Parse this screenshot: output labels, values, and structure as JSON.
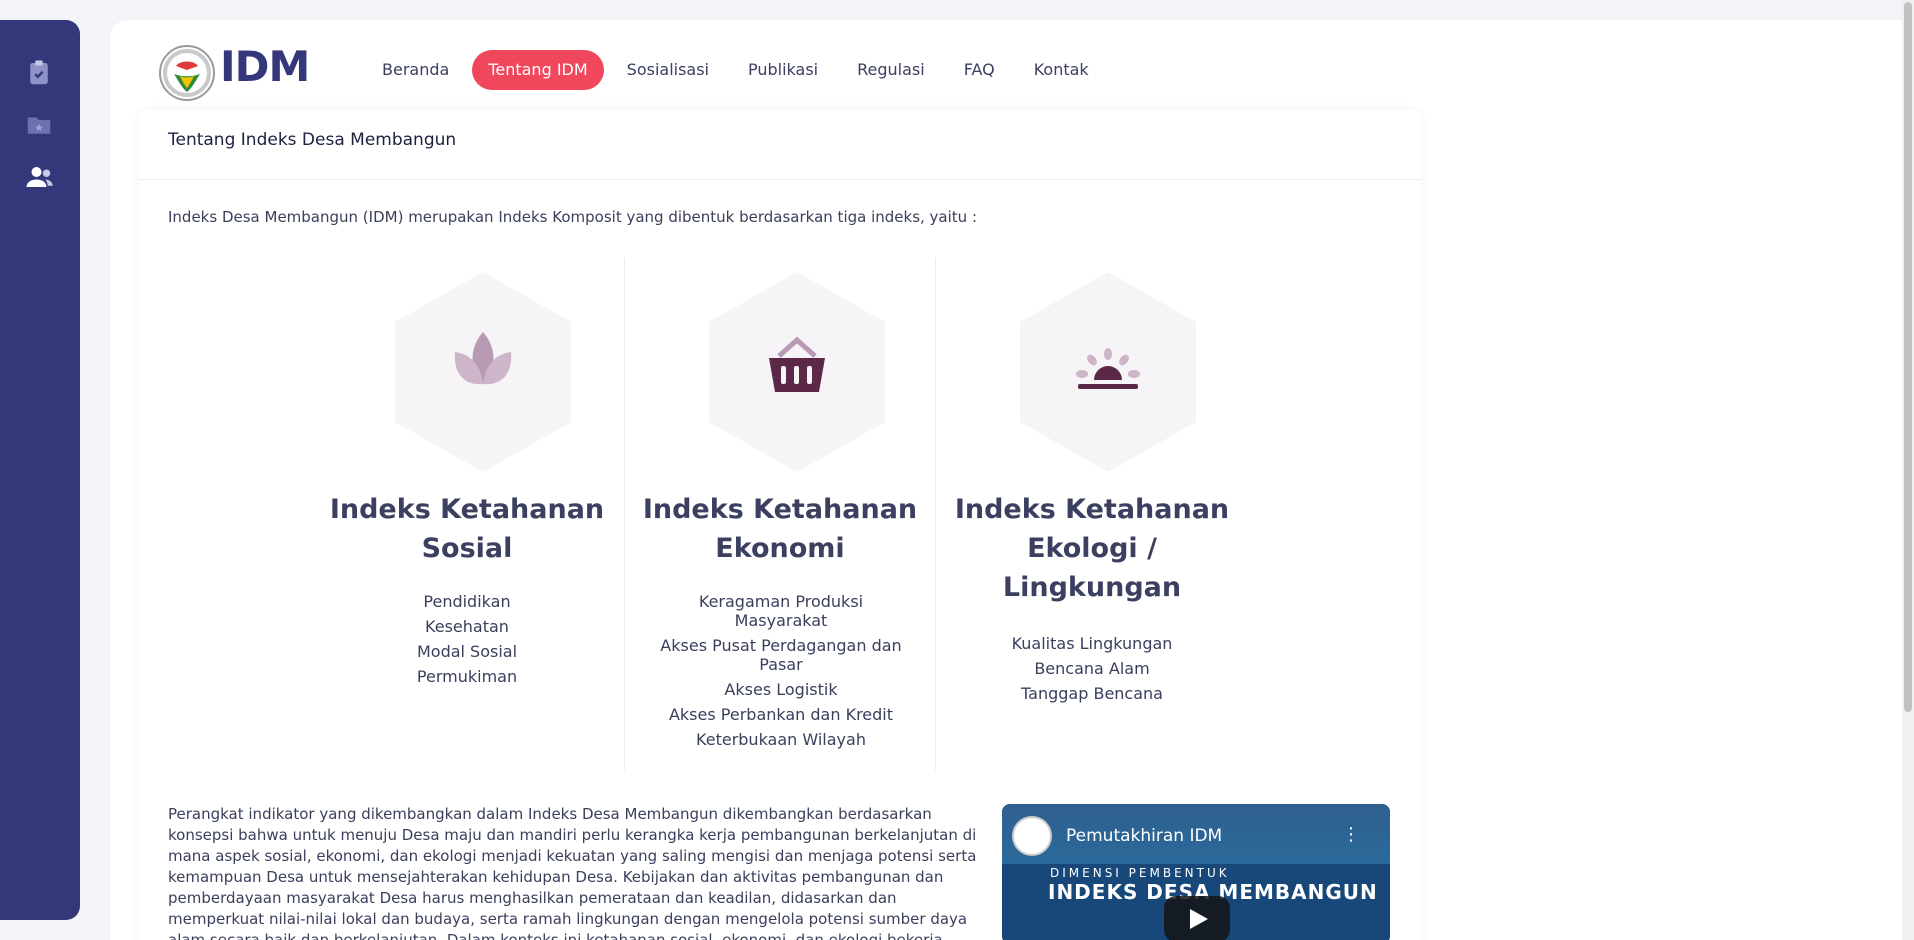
{
  "colors": {
    "sidebar": "#34387a",
    "accent": "#f0475c",
    "brand": "#34387a"
  },
  "sidebar": {
    "icons": [
      {
        "name": "clipboard-check-icon"
      },
      {
        "name": "folder-star-icon"
      },
      {
        "name": "user-group-icon"
      }
    ]
  },
  "brand": {
    "logo_text": "IDM"
  },
  "nav": {
    "items": [
      {
        "label": "Beranda"
      },
      {
        "label": "Tentang IDM"
      },
      {
        "label": "Sosialisasi"
      },
      {
        "label": "Publikasi"
      },
      {
        "label": "Regulasi"
      },
      {
        "label": "FAQ"
      },
      {
        "label": "Kontak"
      }
    ],
    "active": "Tentang IDM"
  },
  "card": {
    "title": "Tentang Indeks Desa Membangun",
    "intro": "Indeks Desa Membangun (IDM) merupakan Indeks Komposit yang dibentuk berdasarkan tiga indeks, yaitu :"
  },
  "indices": [
    {
      "icon": "lotus-icon",
      "title_line1": "Indeks Ketahanan",
      "title_line2": "Sosial",
      "title_line3": "",
      "items": [
        "Pendidikan",
        "Kesehatan",
        "Modal Sosial",
        "Permukiman"
      ]
    },
    {
      "icon": "basket-icon",
      "title_line1": "Indeks Ketahanan",
      "title_line2": "Ekonomi",
      "title_line3": "",
      "items": [
        "Keragaman Produksi Masyarakat",
        "Akses Pusat Perdagangan dan Pasar",
        "Akses Logistik",
        "Akses Perbankan dan Kredit",
        "Keterbukaan Wilayah"
      ]
    },
    {
      "icon": "sunrise-icon",
      "title_line1": "Indeks Ketahanan",
      "title_line2": "Ekologi /",
      "title_line3": "Lingkungan",
      "items": [
        "Kualitas Lingkungan",
        "Bencana Alam",
        "Tanggap Bencana"
      ]
    }
  ],
  "body_text": "Perangkat indikator yang dikembangkan dalam Indeks Desa Membangun dikembangkan berdasarkan konsepsi bahwa untuk menuju Desa maju dan mandiri perlu kerangka kerja pembangunan berkelanjutan di mana aspek sosial, ekonomi, dan ekologi menjadi kekuatan yang saling mengisi dan menjaga potensi serta kemampuan Desa untuk mensejahterakan kehidupan Desa. Kebijakan dan aktivitas pembangunan dan pemberdayaan masyarakat Desa harus menghasilkan pemerataan dan keadilan, didasarkan dan memperkuat nilai-nilai lokal dan budaya, serta ramah lingkungan dengan mengelola potensi sumber daya alam secara baik dan berkelanjutan. Dalam konteks ini ketahanan sosial, ekonomi, dan ekologi bekerja sebagai dimensi yang memperkuat gerak proses dan",
  "video": {
    "title": "Pemutakhiran IDM",
    "subtitle": "DIMENSI PEMBENTUK",
    "heading": "INDEKS DESA MEMBANGUN"
  }
}
